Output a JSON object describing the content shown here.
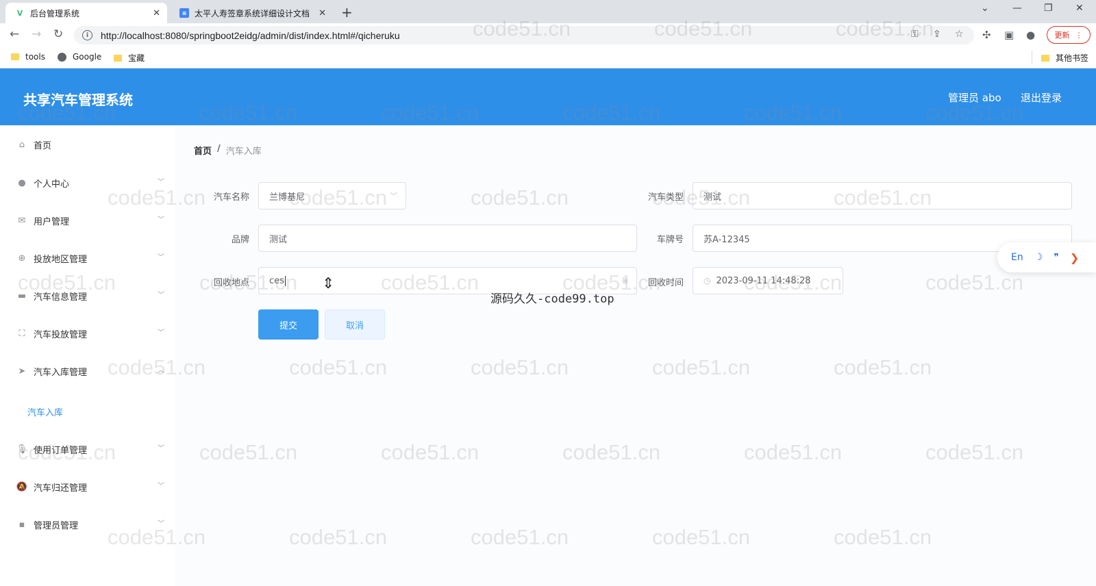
{
  "browser": {
    "tabs": [
      {
        "title": "后台管理系统",
        "icon": "vue-icon",
        "active": true
      },
      {
        "title": "太平人寿签章系统详细设计文档",
        "icon": "doc-icon",
        "active": false
      }
    ],
    "url": "http://localhost:8080/springboot2eidg/admin/dist/index.html#/qicheruku",
    "update_label": "更新",
    "bookmarks": [
      "tools",
      "Google",
      "宝藏"
    ],
    "other_bookmarks": "其他书签"
  },
  "header": {
    "title": "共享汽车管理系统",
    "user": "管理员 abo",
    "logout": "退出登录",
    "color": "#2e8fe9"
  },
  "sidebar": {
    "items": [
      {
        "label": "首页",
        "icon": "home-icon"
      },
      {
        "label": "个人中心",
        "icon": "user-icon"
      },
      {
        "label": "用户管理",
        "icon": "mail-icon"
      },
      {
        "label": "投放地区管理",
        "icon": "compass-icon"
      },
      {
        "label": "汽车信息管理",
        "icon": "monitor-icon"
      },
      {
        "label": "汽车投放管理",
        "icon": "fullscreen-icon"
      },
      {
        "label": "汽车入库管理",
        "icon": "send-icon"
      },
      {
        "label": "使用订单管理",
        "icon": "microphone-icon"
      },
      {
        "label": "汽车归还管理",
        "icon": "bell-off-icon"
      },
      {
        "label": "管理员管理",
        "icon": "chat-icon"
      }
    ],
    "active_sub": "汽车入库"
  },
  "breadcrumb": {
    "home": "首页",
    "separator": "/",
    "current": "汽车入库"
  },
  "form": {
    "car_name_label": "汽车名称",
    "car_name_value": "兰博基尼",
    "car_type_label": "汽车类型",
    "car_type_value": "测试",
    "brand_label": "品牌",
    "brand_value": "测试",
    "plate_label": "车牌号",
    "plate_value": "苏A-12345",
    "location_label": "回收地点",
    "location_value": "ces",
    "time_label": "回收时间",
    "time_value": "2023-09-11 14:48:28",
    "submit": "提交",
    "cancel": "取消"
  },
  "overlay_text": "源码久久-code99.top",
  "translate_widget": {
    "lang": "En"
  },
  "watermark_text": "code51.cn"
}
